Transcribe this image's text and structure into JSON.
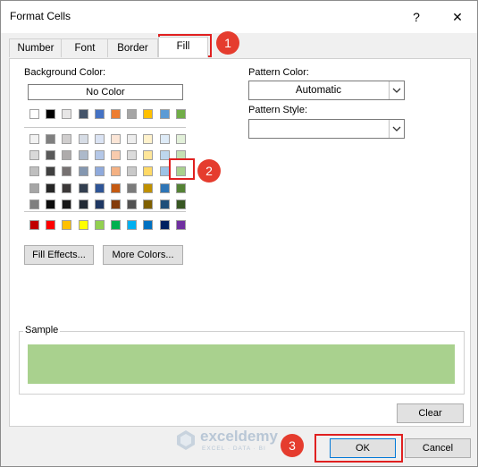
{
  "window": {
    "title": "Format Cells",
    "help": "?",
    "close": "✕"
  },
  "tabs": [
    {
      "label": "Number"
    },
    {
      "label": "Font"
    },
    {
      "label": "Border"
    },
    {
      "label": "Fill"
    }
  ],
  "background": {
    "label": "Background Color:",
    "no_color": "No Color"
  },
  "theme_colors": {
    "row0": [
      "#ffffff",
      "#000000",
      "#e7e6e6",
      "#44546a",
      "#4472c4",
      "#ed7d31",
      "#a5a5a5",
      "#ffc000",
      "#5b9bd5",
      "#70ad47"
    ],
    "rows": [
      [
        "#f2f2f2",
        "#7f7f7f",
        "#d0cece",
        "#d6dce5",
        "#dae3f3",
        "#fbe5d6",
        "#ededed",
        "#fff2cc",
        "#deebf7",
        "#e2f0d9"
      ],
      [
        "#d9d9d9",
        "#595959",
        "#aeabab",
        "#adb9ca",
        "#b4c7e7",
        "#f8cbad",
        "#dbdbdb",
        "#ffe699",
        "#bdd7ee",
        "#c5e0b4"
      ],
      [
        "#bfbfbf",
        "#404040",
        "#767171",
        "#8497b0",
        "#8faadc",
        "#f4b183",
        "#c9c9c9",
        "#ffd966",
        "#9dc3e6",
        "#a9d18e"
      ],
      [
        "#a6a6a6",
        "#262626",
        "#3b3838",
        "#333f50",
        "#2f5597",
        "#c55a11",
        "#7b7b7b",
        "#bf9000",
        "#2e75b6",
        "#548235"
      ],
      [
        "#7f7f7f",
        "#0d0d0d",
        "#171717",
        "#222a35",
        "#1f3864",
        "#843c0c",
        "#525252",
        "#7f6000",
        "#1f4e79",
        "#385723"
      ]
    ]
  },
  "standard_colors": [
    "#c00000",
    "#ff0000",
    "#ffc000",
    "#ffff00",
    "#92d050",
    "#00b050",
    "#00b0f0",
    "#0070c0",
    "#002060",
    "#7030a0"
  ],
  "buttons": {
    "fill_effects": "Fill Effects...",
    "more_colors": "More Colors...",
    "clear": "Clear",
    "ok": "OK",
    "cancel": "Cancel"
  },
  "pattern": {
    "color_label": "Pattern Color:",
    "color_value": "Automatic",
    "style_label": "Pattern Style:",
    "style_value": ""
  },
  "sample": {
    "label": "Sample",
    "color": "#a9d18e"
  },
  "annotations": [
    "1",
    "2",
    "3"
  ],
  "watermark": {
    "name": "exceldemy",
    "tagline": "EXCEL · DATA · BI"
  }
}
